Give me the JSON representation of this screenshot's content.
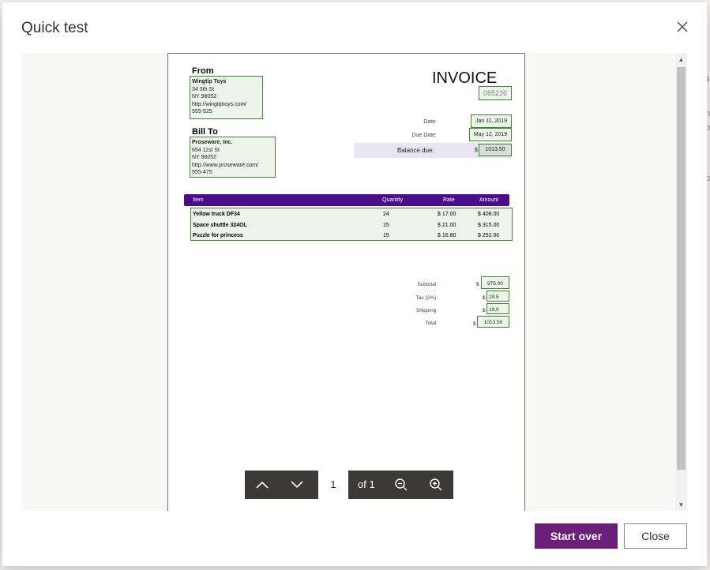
{
  "dialog": {
    "title": "Quick test",
    "buttons": {
      "start_over": "Start over",
      "close": "Close"
    }
  },
  "background_fragments": [
    "se",
    "n",
    "p",
    "p"
  ],
  "invoice": {
    "from_heading": "From",
    "from": [
      "Wingtip Toys",
      "34 5th St",
      "NY 98052",
      "http://wingtiptoys.com/",
      "555-525"
    ],
    "title": "INVOICE",
    "number": "085236",
    "bill_to_heading": "Bill To",
    "bill_to": [
      "Proseware, Inc.",
      "654 11st St",
      "NY 98052",
      "http://www.proseware.com/",
      "555-475"
    ],
    "date_label": "Date:",
    "date": "Jan 11, 2019",
    "due_label": "Due Date:",
    "due": "May 12, 2019",
    "balance_label": "Balance due:",
    "balance_currency": "$",
    "balance": "1013.50",
    "columns": [
      "Item",
      "Quantity",
      "Rate",
      "Amount"
    ],
    "items": [
      {
        "name": "Yellow truck DF34",
        "qty": "24",
        "rate": "$ 17.00",
        "amount": "$ 408.00"
      },
      {
        "name": "Space shuttle 324OL",
        "qty": "15",
        "rate": "$ 21.00",
        "amount": "$ 315.00"
      },
      {
        "name": "Puzzle for princess",
        "qty": "15",
        "rate": "$ 16.80",
        "amount": "$ 252.00"
      }
    ],
    "totals": [
      {
        "label": "Subtotal:",
        "currency": "$",
        "value": "975.00"
      },
      {
        "label": "Tax (2%):",
        "currency": "$",
        "value": "19.5"
      },
      {
        "label": "Shipping:",
        "currency": "$",
        "value": "19.0"
      },
      {
        "label": "Total:",
        "currency": "$",
        "value": "1013.50"
      }
    ]
  },
  "pager": {
    "current_page": "1",
    "of_label": "of 1"
  },
  "icons": [
    "close-icon",
    "chevron-up-icon",
    "chevron-down-icon",
    "zoom-out-icon",
    "zoom-in-icon"
  ],
  "colors": {
    "primary": "#6b1f7b",
    "table_header": "#4b0d8c",
    "field_box": "#3c8a2e"
  }
}
